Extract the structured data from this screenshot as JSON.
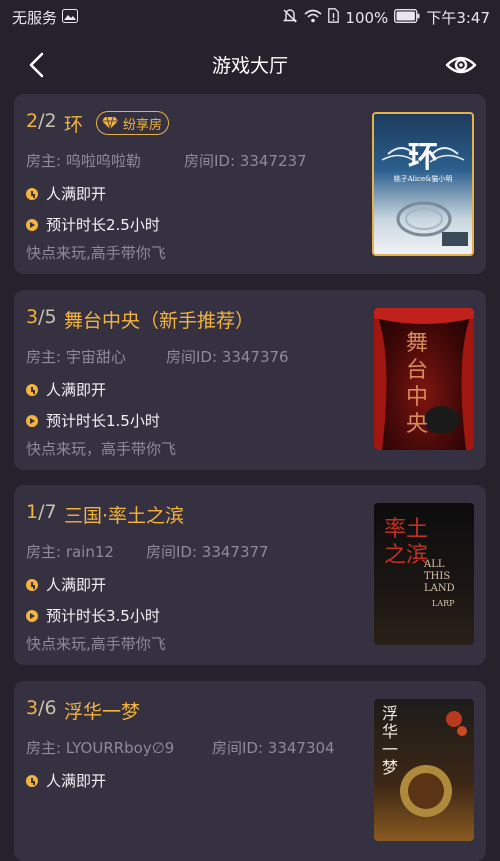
{
  "status_bar": {
    "carrier": "无服务",
    "battery": "100%",
    "time": "下午3:47"
  },
  "header": {
    "title": "游戏大厅"
  },
  "labels": {
    "host_prefix": "房主: ",
    "room_prefix": "房间ID: ",
    "share_badge": "纷享房"
  },
  "rooms": [
    {
      "current": "2",
      "max": "2",
      "name": "环",
      "host": "呜啦呜啦勒",
      "room_id": "3347237",
      "status": "人满即开",
      "duration": "预计时长2.5小时",
      "slogan": "快点来玩,高手带你飞",
      "poster_title": "环",
      "poster_sub": "桃子Alice&猫小明"
    },
    {
      "current": "3",
      "max": "5",
      "name": "舞台中央（新手推荐）",
      "host": "宇宙甜心",
      "room_id": "3347376",
      "status": "人满即开",
      "duration": "预计时长1.5小时",
      "slogan": "快点来玩，高手带你飞",
      "poster_title": "舞台中央"
    },
    {
      "current": "1",
      "max": "7",
      "name": "三国·率土之滨",
      "host": "rain12",
      "room_id": "3347377",
      "status": "人满即开",
      "duration": "预计时长3.5小时",
      "slogan": "快点来玩,高手带你飞",
      "poster_title": "率土之滨",
      "poster_sub": "ALL THIS LAND",
      "poster_tag": "LARP"
    },
    {
      "current": "3",
      "max": "6",
      "name": "浮华一梦",
      "host": "LYOURRboy∅9",
      "room_id": "3347304",
      "status": "人满即开",
      "poster_title": "浮华一梦"
    }
  ],
  "colors": {
    "background": "#25222c",
    "card": "#353141",
    "accent": "#f4b33d",
    "muted": "#8f8a99"
  },
  "icons": {
    "back": "chevron-left-icon",
    "eye": "eye-icon",
    "clock": "clock-icon",
    "play": "play-circle-icon",
    "diamond": "diamond-icon"
  }
}
